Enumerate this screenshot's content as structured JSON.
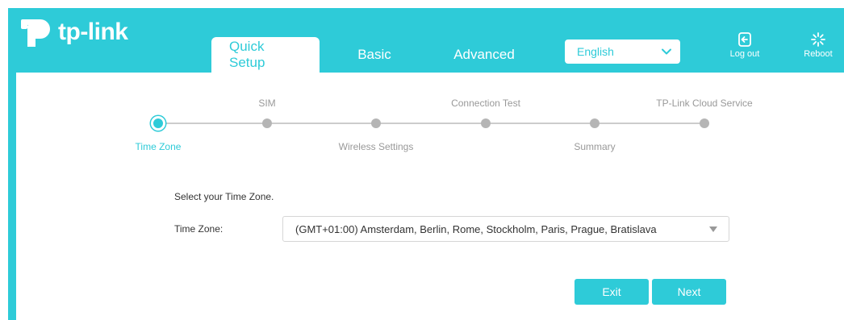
{
  "brand": {
    "logo_text": "tp-link",
    "accent_color": "#2ecbd8"
  },
  "header": {
    "tabs": [
      {
        "label": "Quick Setup",
        "active": true
      },
      {
        "label": "Basic",
        "active": false
      },
      {
        "label": "Advanced",
        "active": false
      }
    ],
    "language": {
      "selected": "English"
    },
    "logout_label": "Log out",
    "reboot_label": "Reboot",
    "icons": {
      "logout": "logout-icon",
      "reboot": "reboot-icon",
      "language_arrow": "chevron-down-icon"
    }
  },
  "stepper": {
    "steps": [
      {
        "label": "Time Zone",
        "position": "bottom",
        "current": true
      },
      {
        "label": "SIM",
        "position": "top",
        "current": false
      },
      {
        "label": "Wireless Settings",
        "position": "bottom",
        "current": false
      },
      {
        "label": "Connection Test",
        "position": "top",
        "current": false
      },
      {
        "label": "Summary",
        "position": "bottom",
        "current": false
      },
      {
        "label": "TP-Link Cloud Service",
        "position": "top",
        "current": false
      }
    ]
  },
  "form": {
    "prompt": "Select your Time Zone.",
    "time_zone_label": "Time Zone:",
    "time_zone_value": "(GMT+01:00) Amsterdam, Berlin, Rome, Stockholm, Paris, Prague, Bratislava"
  },
  "actions": {
    "exit_label": "Exit",
    "next_label": "Next"
  }
}
